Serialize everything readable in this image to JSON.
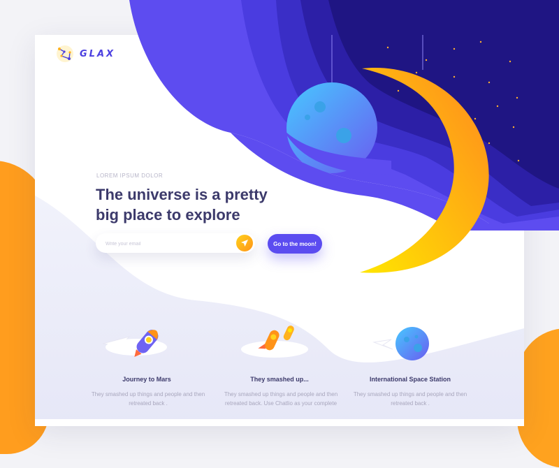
{
  "brand": {
    "name": "GLAX",
    "logo_icon": "constellation-icon"
  },
  "hero": {
    "eyebrow": "LOREM IPSUM DOLOR",
    "headline": "The universe is a pretty big place to explore"
  },
  "signup": {
    "email_placeholder": "Write your email",
    "send_icon": "send-arrow-icon",
    "cta_label": "Go to the moon!"
  },
  "features": [
    {
      "title": "Journey to Mars",
      "description": "They smashed up things and people and then retreated back .",
      "icon": "rocket-icon"
    },
    {
      "title": "They smashed up...",
      "description": "They smashed up things and people and then retreated back. Use Chatlio as your complete",
      "icon": "double-rocket-icon"
    },
    {
      "title": "International Space Station",
      "description": "They smashed up things and people and then retreated back .",
      "icon": "planet-icon"
    }
  ],
  "colors": {
    "accent": "#5b4cf0",
    "moon_start": "#ffe600",
    "moon_end": "#ff8a1e",
    "background_blob": "#ff9d1e",
    "heading": "#3c3a6b"
  }
}
